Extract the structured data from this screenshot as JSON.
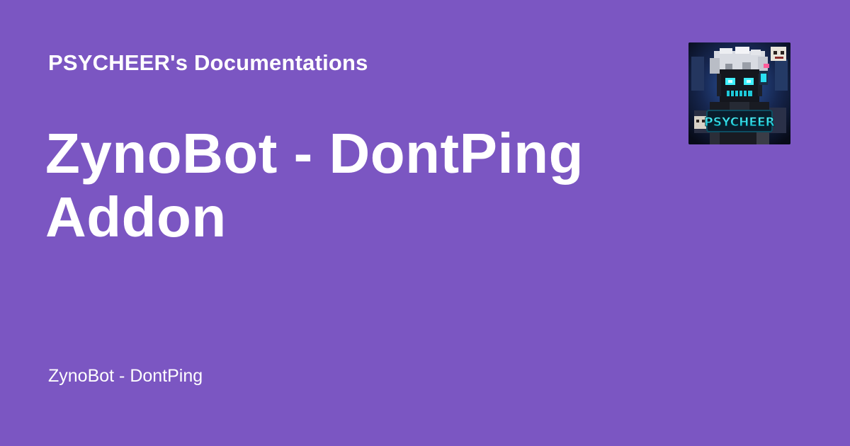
{
  "brand": {
    "site_name": "PSYCHEER's Documentations",
    "background_color": "#7b56c2",
    "logo_text": "PSYCHEER",
    "logo_icon": "psycheer-avatar-logo"
  },
  "page": {
    "title": "ZynoBot - DontPing Addon",
    "subtitle": "ZynoBot - DontPing"
  }
}
